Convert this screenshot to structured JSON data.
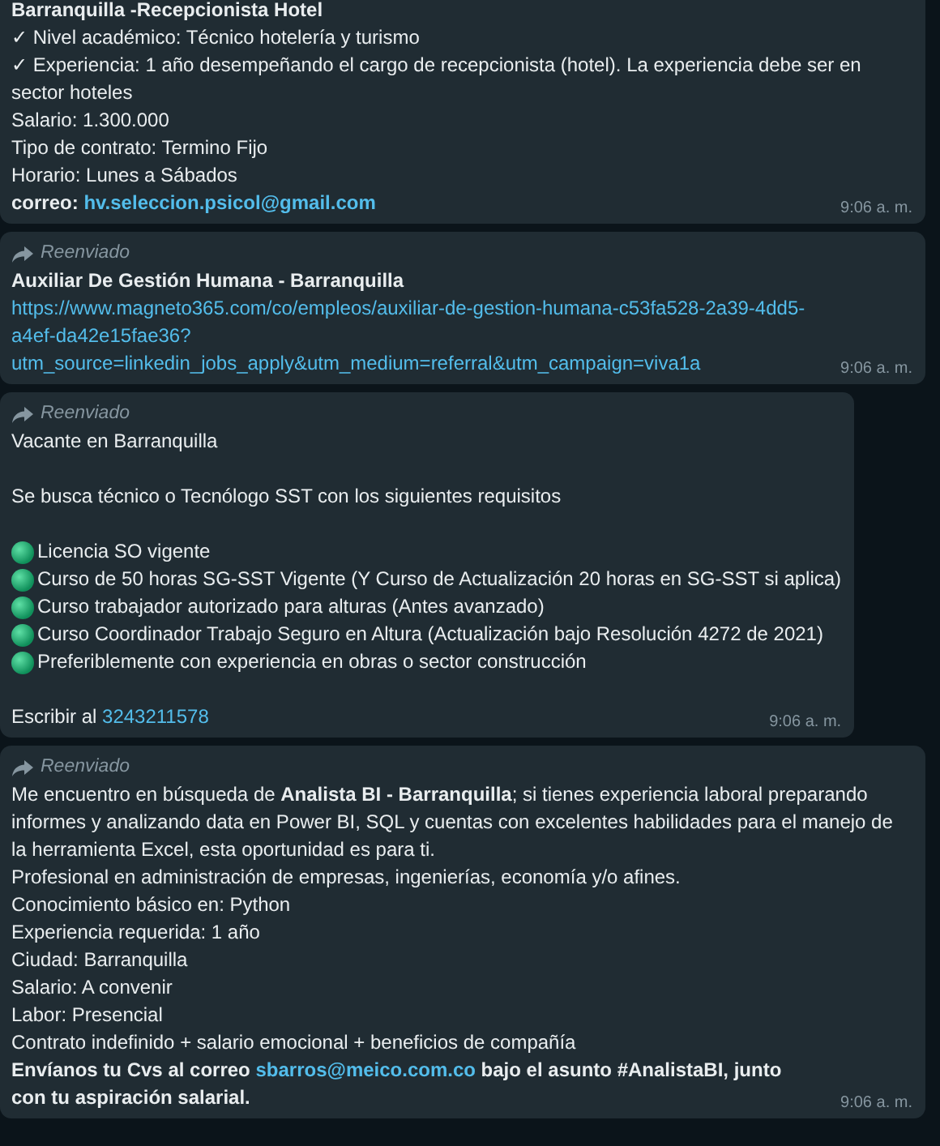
{
  "messages": [
    {
      "forwarded": false,
      "time": "9:06 a. m.",
      "lines": [
        {
          "parts": [
            {
              "kind": "text",
              "bold": true,
              "text": "Barranquilla -Recepcionista Hotel"
            }
          ]
        },
        {
          "parts": [
            {
              "kind": "text",
              "bold": false,
              "text": "✓ Nivel académico: Técnico hotelería y turismo"
            }
          ]
        },
        {
          "parts": [
            {
              "kind": "text",
              "bold": false,
              "text": "✓ Experiencia: 1 año desempeñando el cargo de recepcionista (hotel). La experiencia debe ser en sector hoteles"
            }
          ]
        },
        {
          "parts": [
            {
              "kind": "text",
              "bold": false,
              "text": "Salario: 1.300.000"
            }
          ]
        },
        {
          "parts": [
            {
              "kind": "text",
              "bold": false,
              "text": "Tipo de contrato: Termino Fijo"
            }
          ]
        },
        {
          "parts": [
            {
              "kind": "text",
              "bold": false,
              "text": "Horario: Lunes a Sábados"
            }
          ]
        },
        {
          "parts": [
            {
              "kind": "text",
              "bold": true,
              "text": "correo: "
            },
            {
              "kind": "link",
              "bold": true,
              "text": "hv.seleccion.psicol@gmail.com"
            }
          ]
        }
      ]
    },
    {
      "forwarded": true,
      "forwarded_label": "Reenviado",
      "time": "9:06 a. m.",
      "lines": [
        {
          "parts": [
            {
              "kind": "text",
              "bold": true,
              "text": "Auxiliar De Gestión Humana - Barranquilla"
            }
          ]
        },
        {
          "parts": [
            {
              "kind": "link",
              "bold": false,
              "text": "https://www.magneto365.com/co/empleos/auxiliar-de-gestion-humana-c53fa528-2a39-4dd5-a4ef-da42e15fae36?utm_source=linkedin_jobs_apply&utm_medium=referral&utm_campaign=viva1a"
            }
          ]
        }
      ]
    },
    {
      "forwarded": true,
      "forwarded_label": "Reenviado",
      "time": "9:06 a. m.",
      "lines": [
        {
          "parts": [
            {
              "kind": "text",
              "bold": false,
              "text": "Vacante en Barranquilla"
            }
          ]
        },
        {
          "space_before": true,
          "parts": [
            {
              "kind": "text",
              "bold": false,
              "text": "Se busca técnico o Tecnólogo SST con los siguientes requisitos"
            }
          ]
        },
        {
          "space_before": true,
          "bullet": true,
          "parts": [
            {
              "kind": "text",
              "bold": false,
              "text": "Licencia SO vigente"
            }
          ]
        },
        {
          "bullet": true,
          "parts": [
            {
              "kind": "text",
              "bold": false,
              "text": "Curso de 50 horas SG-SST Vigente (Y Curso de Actualización  20 horas en SG-SST si aplica)"
            }
          ]
        },
        {
          "bullet": true,
          "parts": [
            {
              "kind": "text",
              "bold": false,
              "text": "Curso trabajador autorizado para alturas (Antes avanzado)"
            }
          ]
        },
        {
          "bullet": true,
          "parts": [
            {
              "kind": "text",
              "bold": false,
              "text": "Curso Coordinador Trabajo Seguro en Altura (Actualización bajo Resolución 4272 de 2021)"
            }
          ]
        },
        {
          "bullet": true,
          "parts": [
            {
              "kind": "text",
              "bold": false,
              "text": "Preferiblemente con experiencia en obras o sector construcción"
            }
          ]
        },
        {
          "space_before": true,
          "parts": [
            {
              "kind": "text",
              "bold": false,
              "text": "Escribir al "
            },
            {
              "kind": "link",
              "bold": false,
              "text": "3243211578"
            }
          ]
        }
      ]
    },
    {
      "forwarded": true,
      "forwarded_label": "Reenviado",
      "time": "9:06 a. m.",
      "lines": [
        {
          "parts": [
            {
              "kind": "text",
              "bold": false,
              "text": "Me encuentro en búsqueda de **Analista BI - Barranquilla**; si tienes experiencia laboral preparando informes y analizando data en Power BI, SQL y cuentas con excelentes habilidades para el manejo de la herramienta Excel, esta oportunidad es para ti."
            }
          ]
        },
        {
          "parts": [
            {
              "kind": "text",
              "bold": false,
              "text": "Profesional en administración de empresas, ingenierías, economía y/o afines."
            }
          ]
        },
        {
          "parts": [
            {
              "kind": "text",
              "bold": false,
              "text": "Conocimiento básico en: Python"
            }
          ]
        },
        {
          "parts": [
            {
              "kind": "text",
              "bold": false,
              "text": "Experiencia requerida: 1 año"
            }
          ]
        },
        {
          "parts": [
            {
              "kind": "text",
              "bold": false,
              "text": "Ciudad: Barranquilla"
            }
          ]
        },
        {
          "parts": [
            {
              "kind": "text",
              "bold": false,
              "text": "Salario: A convenir"
            }
          ]
        },
        {
          "parts": [
            {
              "kind": "text",
              "bold": false,
              "text": "Labor: Presencial"
            }
          ]
        },
        {
          "parts": [
            {
              "kind": "text",
              "bold": false,
              "text": "Contrato indefinido + salario emocional + beneficios de compañía"
            }
          ]
        },
        {
          "parts": [
            {
              "kind": "text",
              "bold": true,
              "text": "Envíanos tu Cvs al correo "
            },
            {
              "kind": "link",
              "bold": true,
              "text": "sbarros@meico.com.co"
            },
            {
              "kind": "text",
              "bold": true,
              "text": " bajo el asunto #AnalistaBI, junto con tu aspiración salarial."
            }
          ]
        }
      ]
    }
  ]
}
